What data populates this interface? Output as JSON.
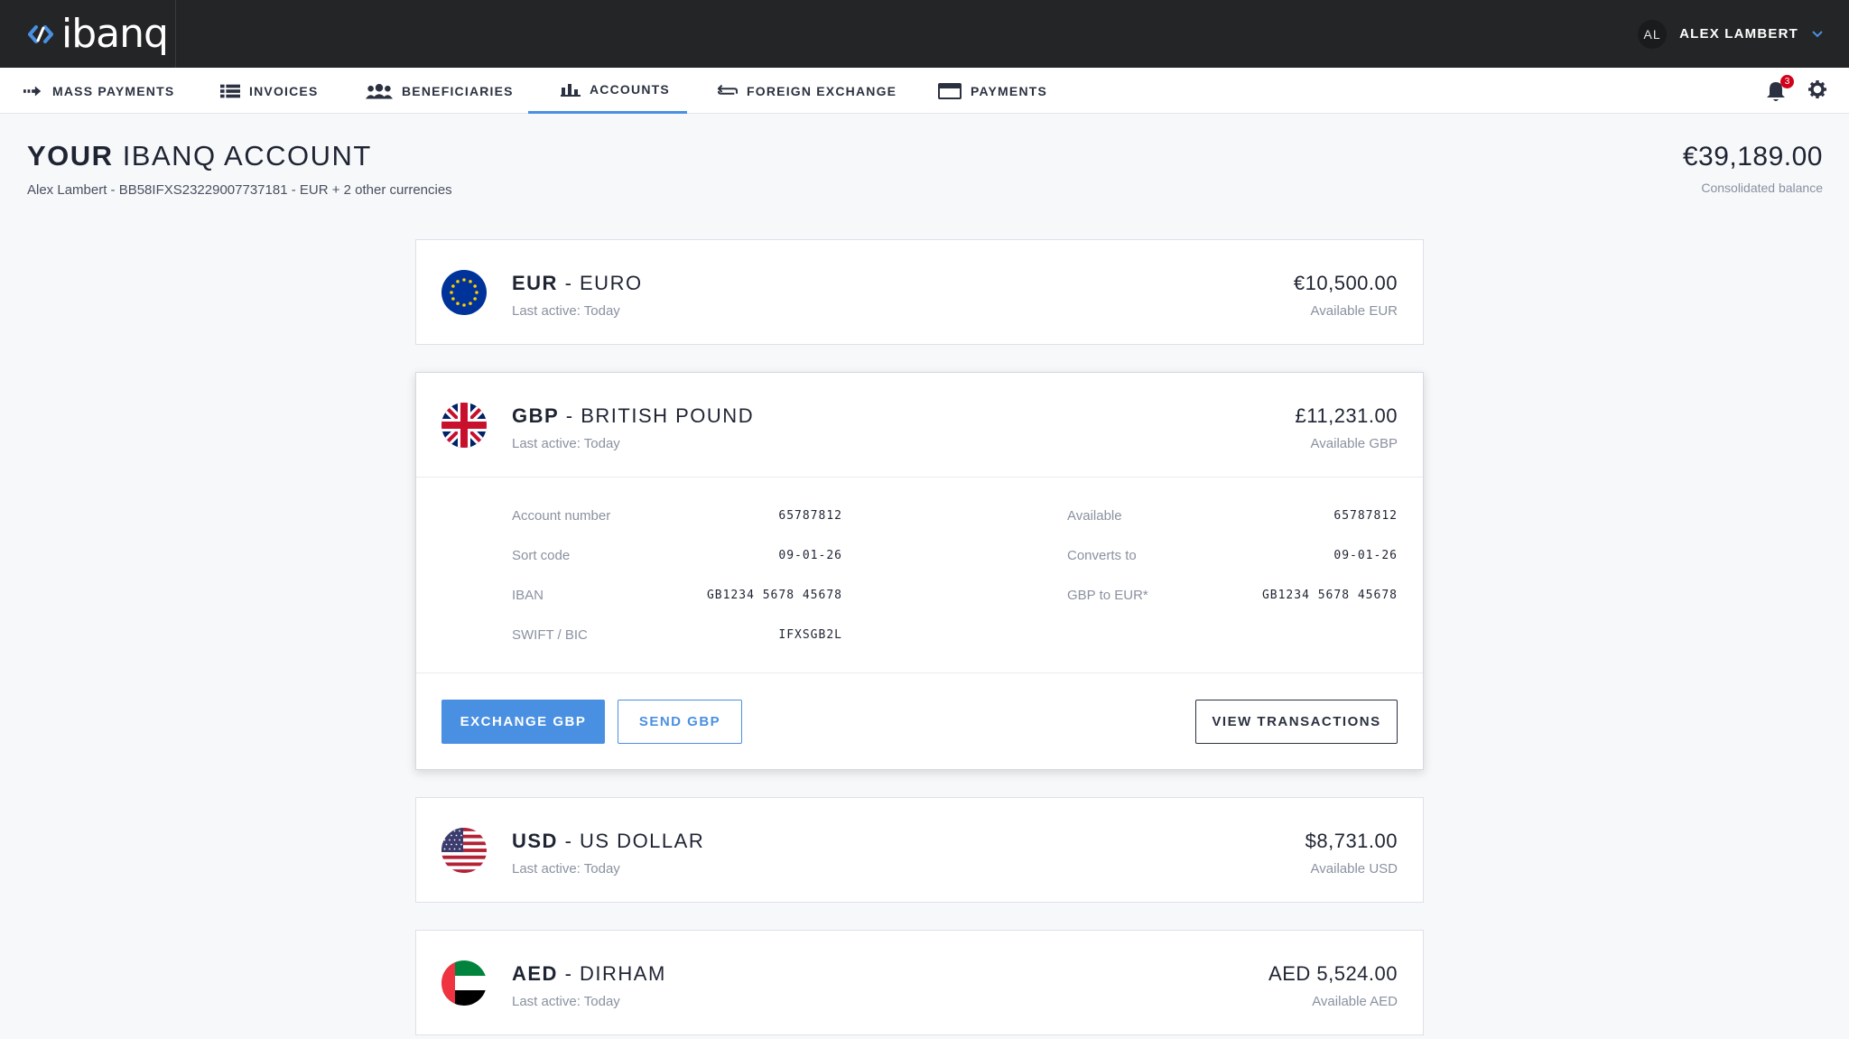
{
  "app": {
    "logo_text": "ibanq"
  },
  "user": {
    "initials": "AL",
    "name": "ALEX LAMBERT"
  },
  "nav": {
    "items": [
      {
        "label": "MASS PAYMENTS"
      },
      {
        "label": "INVOICES"
      },
      {
        "label": "BENEFICIARIES"
      },
      {
        "label": "ACCOUNTS"
      },
      {
        "label": "FOREIGN EXCHANGE"
      },
      {
        "label": "PAYMENTS"
      }
    ],
    "active_index": 3,
    "notifications_count": "3"
  },
  "header": {
    "title_bold": "YOUR",
    "title_rest": " IBANQ ACCOUNT",
    "subtitle": "Alex Lambert - BB58IFXS23229007737181 - EUR + 2 other currencies",
    "balance": "€39,189.00",
    "balance_label": "Consolidated balance"
  },
  "accounts": [
    {
      "code": "EUR",
      "name": " - EURO",
      "last_active": "Last active: Today",
      "amount": "€10,500.00",
      "available": "Available EUR"
    },
    {
      "code": "GBP",
      "name": " - BRITISH POUND",
      "last_active": "Last active: Today",
      "amount": "£11,231.00",
      "available": "Available GBP",
      "details": {
        "left": [
          {
            "label": "Account number",
            "value": "65787812"
          },
          {
            "label": "Sort code",
            "value": "09-01-26"
          },
          {
            "label": "IBAN",
            "value": "GB1234 5678 45678"
          },
          {
            "label": "SWIFT / BIC",
            "value": "IFXSGB2L"
          }
        ],
        "right": [
          {
            "label": "Available",
            "value": "65787812"
          },
          {
            "label": "Converts to",
            "value": "09-01-26"
          },
          {
            "label": "GBP to EUR*",
            "value": "GB1234 5678 45678"
          }
        ]
      },
      "actions": {
        "exchange": "EXCHANGE GBP",
        "send": "SEND GBP",
        "view": "VIEW TRANSACTIONS"
      }
    },
    {
      "code": "USD",
      "name": " - US DOLLAR",
      "last_active": "Last active: Today",
      "amount": "$8,731.00",
      "available": "Available USD"
    },
    {
      "code": "AED",
      "name": " - DIRHAM",
      "last_active": "Last active: Today",
      "amount": "AED 5,524.00",
      "available": "Available AED"
    }
  ],
  "colors": {
    "accent": "#4a90e2",
    "topbar": "#242526",
    "badge": "#d0021b"
  }
}
